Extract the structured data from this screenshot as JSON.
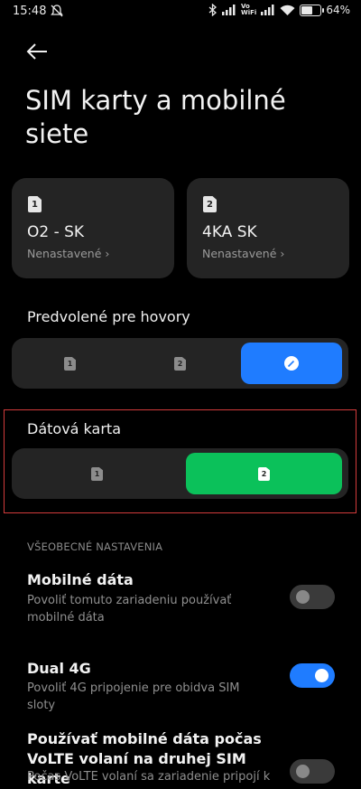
{
  "status_bar": {
    "time": "15:48",
    "volte_label_top": "Vo",
    "volte_label_bottom": "WiFi",
    "battery_level": "64%",
    "battery_fraction": 0.64
  },
  "header": {
    "back_icon": "arrow-left-icon",
    "title": "SIM karty a mobilné siete"
  },
  "sim_cards": [
    {
      "slot": "1",
      "name": "O2 - SK",
      "status": "Nenastavené ›"
    },
    {
      "slot": "2",
      "name": "4KA SK",
      "status": "Nenastavené ›"
    }
  ],
  "calls_default": {
    "label": "Predvolené pre hovory",
    "options": [
      "1",
      "2"
    ],
    "selected_icon": "edit-icon",
    "accent": "#1f7cff"
  },
  "data_card": {
    "label": "Dátová karta",
    "options": [
      "1",
      "2"
    ],
    "selected": "2",
    "accent": "#0bc15a"
  },
  "general_settings": {
    "header": "VŠEOBECNÉ NASTAVENIA",
    "rows": [
      {
        "title": "Mobilné dáta",
        "subtitle": "Povoliť tomuto zariadeniu používať mobilné dáta",
        "enabled": false
      },
      {
        "title": "Dual 4G",
        "subtitle": "Povoliť 4G pripojenie pre obidva SIM sloty",
        "enabled": true
      },
      {
        "title": "Používať mobilné dáta počas VoLTE volaní na druhej SIM karte",
        "subtitle": "Počas VoLTE volaní sa zariadenie pripojí k",
        "enabled": false
      }
    ]
  },
  "colors": {
    "highlight": "#d23b3b",
    "card_bg": "#242424"
  }
}
